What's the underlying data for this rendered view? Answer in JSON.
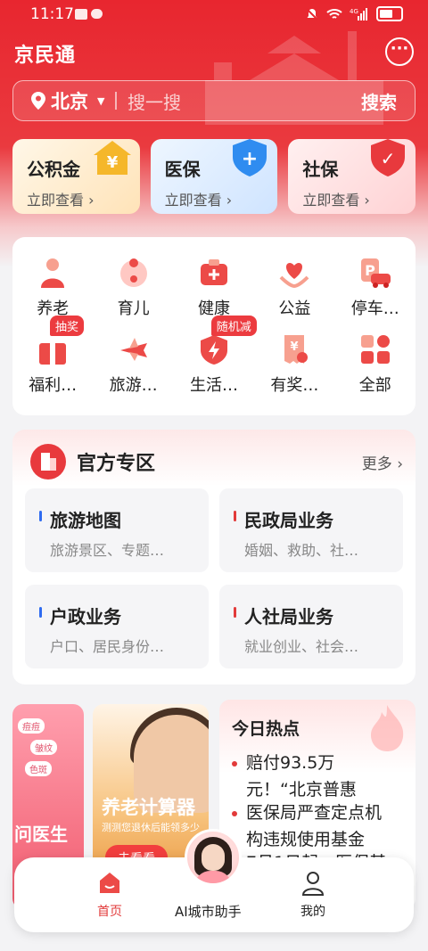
{
  "status_bar": {
    "time": "11:17",
    "network": "4G"
  },
  "header": {
    "app_title": "京民通"
  },
  "search": {
    "city": "北京",
    "placeholder": "搜一搜",
    "button": "搜索"
  },
  "quick_cards": [
    {
      "title": "公积金",
      "sub": "立即查看 ›",
      "badge": "¥"
    },
    {
      "title": "医保",
      "sub": "立即查看 ›",
      "badge": "+"
    },
    {
      "title": "社保",
      "sub": "立即查看 ›",
      "badge": "✓"
    }
  ],
  "services": [
    {
      "label": "养老",
      "icon": "elderly-icon"
    },
    {
      "label": "育儿",
      "icon": "baby-icon"
    },
    {
      "label": "健康",
      "icon": "medical-kit-icon"
    },
    {
      "label": "公益",
      "icon": "heart-hands-icon"
    },
    {
      "label": "停车…",
      "icon": "parking-car-icon"
    },
    {
      "label": "福利…",
      "icon": "gift-icon",
      "tag": "抽奖"
    },
    {
      "label": "旅游…",
      "icon": "plane-icon"
    },
    {
      "label": "生活…",
      "icon": "bolt-shield-icon",
      "tag": "随机减"
    },
    {
      "label": "有奖…",
      "icon": "receipt-award-icon"
    },
    {
      "label": "全部",
      "icon": "grid-icon"
    }
  ],
  "official": {
    "title": "官方专区",
    "more": "更多 ›",
    "items": [
      {
        "title": "旅游地图",
        "sub": "旅游景区、专题…",
        "accent": "#2f6bf0"
      },
      {
        "title": "民政局业务",
        "sub": "婚姻、救助、社…",
        "accent": "#e23a3a"
      },
      {
        "title": "户政业务",
        "sub": "户口、居民身份…",
        "accent": "#2f6bf0"
      },
      {
        "title": "人社局业务",
        "sub": "就业创业、社会…",
        "accent": "#e23a3a"
      }
    ]
  },
  "promo": {
    "left": {
      "title": "问医生",
      "pills": [
        "痘痘",
        "皱纹",
        "色斑"
      ]
    },
    "middle": {
      "title": "养老计算器",
      "sub": "测测您退休后能领多少",
      "button": "去看看"
    }
  },
  "hot": {
    "title": "今日热点",
    "items": [
      {
        "line1": "赔付93.5万",
        "line2": "元！“北京普惠"
      },
      {
        "line1": "医保局严查定点机",
        "line2": "构违规使用基金"
      },
      {
        "line1": "7月1日起，医保基"
      }
    ]
  },
  "tabbar": {
    "home": "首页",
    "ai": "AI城市助手",
    "mine": "我的"
  },
  "colors": {
    "brand_red": "#e8262f",
    "accent_blue": "#2f6bf0"
  }
}
